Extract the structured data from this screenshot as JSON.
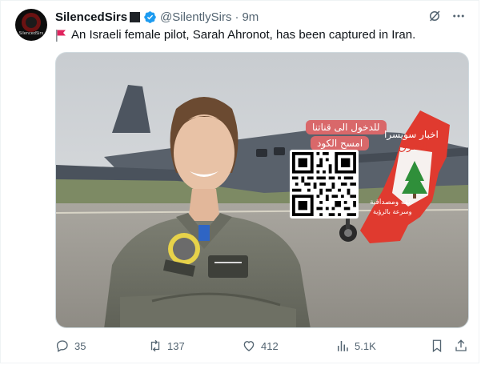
{
  "author": {
    "name": "SilencedSirs",
    "handle": "@SilentlySirs",
    "separator": "·",
    "time": "9m",
    "avatar_text": "SilencedSirs"
  },
  "tweet": {
    "text": "An Israeli female pilot, Sarah Ahronot, has been captured in Iran.",
    "flag_icon": "red-flag-icon"
  },
  "image": {
    "overlay_line1": "للدخول الى قناتنا",
    "overlay_line2": "امسح الكود",
    "map_title": "اخبار سويسرا",
    "map_subtitle": "الشرق",
    "map_tagline1": "ثقة ومصداقية",
    "map_tagline2": "وسرعة بالرؤية"
  },
  "stats": {
    "replies": "35",
    "reposts": "137",
    "likes": "412",
    "views": "5.1K"
  },
  "colors": {
    "verified": "#1d9bf0",
    "flag": "#e0245e",
    "muted": "#536471",
    "overlay": "#d9686a"
  }
}
